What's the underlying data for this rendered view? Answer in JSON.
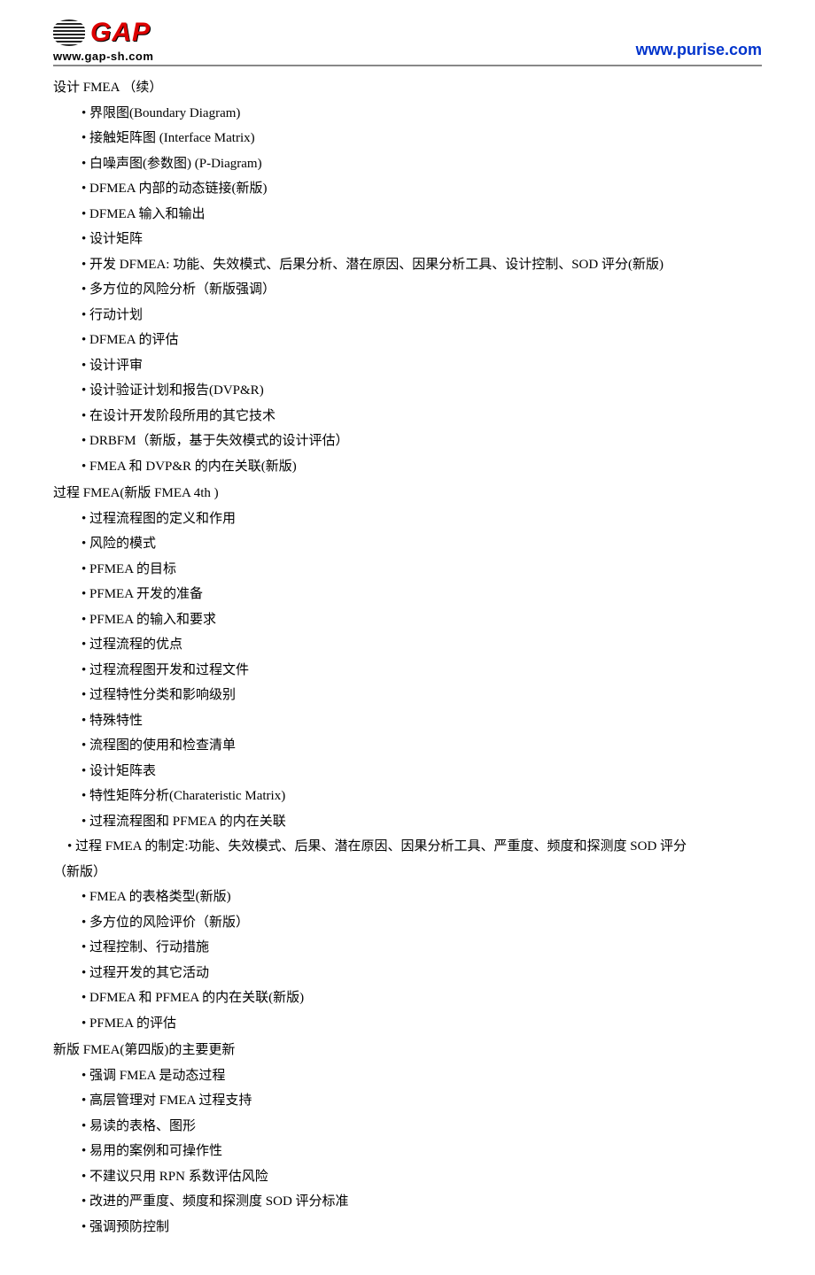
{
  "header": {
    "logo_text": "GAP",
    "logo_url": "www.gap-sh.com",
    "right_url": "www.purise.com"
  },
  "content": {
    "section1": {
      "title": "设计 FMEA （续）",
      "items": [
        "界限图(Boundary Diagram)",
        "接触矩阵图 (Interface Matrix)",
        "白噪声图(参数图) (P-Diagram)",
        "DFMEA 内部的动态链接(新版)",
        "DFMEA 输入和输出",
        "设计矩阵",
        "开发 DFMEA: 功能、失效模式、后果分析、潜在原因、因果分析工具、设计控制、SOD 评分(新版)",
        "多方位的风险分析（新版强调）",
        "行动计划",
        "DFMEA 的评估",
        "设计评审",
        "设计验证计划和报告(DVP&R)",
        "在设计开发阶段所用的其它技术",
        "DRBFM（新版，基于失效模式的设计评估）",
        "FMEA 和 DVP&R 的内在关联(新版)"
      ]
    },
    "section2": {
      "title": "过程 FMEA(新版 FMEA 4th )",
      "items_a": [
        "过程流程图的定义和作用",
        "风险的模式",
        "PFMEA 的目标",
        "PFMEA 开发的准备",
        "PFMEA 的输入和要求",
        "过程流程的优点",
        "过程流程图开发和过程文件",
        "过程特性分类和影响级别",
        "特殊特性",
        "流程图的使用和检查清单",
        "设计矩阵表",
        "特性矩阵分析(Charateristic Matrix)",
        "过程流程图和 PFMEA 的内在关联"
      ],
      "long_item": "过程 FMEA 的制定:功能、失效模式、后果、潜在原因、因果分析工具、严重度、频度和探测度 SOD 评分",
      "long_item_cont": "（新版）",
      "items_b": [
        "FMEA 的表格类型(新版)",
        "多方位的风险评价（新版）",
        "过程控制、行动措施",
        "过程开发的其它活动",
        "DFMEA 和 PFMEA 的内在关联(新版)",
        "PFMEA 的评估"
      ]
    },
    "section3": {
      "title": "新版 FMEA(第四版)的主要更新",
      "items": [
        "强调 FMEA 是动态过程",
        "高层管理对 FMEA 过程支持",
        "易读的表格、图形",
        "易用的案例和可操作性",
        "不建议只用 RPN 系数评估风险",
        "改进的严重度、频度和探测度 SOD 评分标准",
        "强调预防控制"
      ]
    }
  }
}
